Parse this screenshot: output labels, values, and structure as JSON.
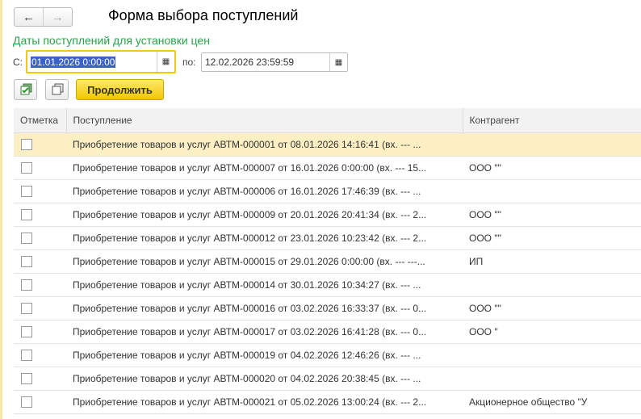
{
  "window": {
    "title": "Форма выбора поступлений"
  },
  "nav": {
    "back": "←",
    "forward": "→"
  },
  "dates": {
    "group_label": "Даты поступлений для установки цен",
    "from_label": "С:",
    "from_value": "01.01.2026  0:00:00",
    "to_label": "по:",
    "to_value": "12.02.2026 23:59:59",
    "calendar_icon": "▦"
  },
  "toolbar": {
    "check_all_icon": "check-all",
    "uncheck_all_icon": "uncheck-all",
    "continue_label": "Продолжить"
  },
  "table": {
    "columns": [
      "Отметка",
      "Поступление",
      "Контрагент"
    ],
    "rows": [
      {
        "doc": "Приобретение товаров и услуг АВТМ-000001 от 08.01.2026 14:16:41 (вх. --- ...",
        "contractor": ""
      },
      {
        "doc": "Приобретение товаров и услуг АВТМ-000007 от 16.01.2026 0:00:00 (вх. --- 15...",
        "contractor": "ООО \"\""
      },
      {
        "doc": "Приобретение товаров и услуг АВТМ-000006 от 16.01.2026 17:46:39 (вх. --- ...",
        "contractor": ""
      },
      {
        "doc": "Приобретение товаров и услуг АВТМ-000009 от 20.01.2026 20:41:34 (вх. --- 2...",
        "contractor": "ООО \"\""
      },
      {
        "doc": "Приобретение товаров и услуг АВТМ-000012 от 23.01.2026 10:23:42 (вх. --- 2...",
        "contractor": "ООО \"\""
      },
      {
        "doc": "Приобретение товаров и услуг АВТМ-000015 от 29.01.2026 0:00:00 (вх. --- ---...",
        "contractor": "ИП"
      },
      {
        "doc": "Приобретение товаров и услуг АВТМ-000014 от 30.01.2026 10:34:27 (вх. --- ...",
        "contractor": ""
      },
      {
        "doc": "Приобретение товаров и услуг АВТМ-000016 от 03.02.2026 16:33:37 (вх. --- 0...",
        "contractor": "ООО \"\""
      },
      {
        "doc": "Приобретение товаров и услуг АВТМ-000017 от 03.02.2026 16:41:28 (вх. --- 0...",
        "contractor": "ООО \""
      },
      {
        "doc": "Приобретение товаров и услуг АВТМ-000019 от 04.02.2026 12:46:26 (вх. --- ...",
        "contractor": ""
      },
      {
        "doc": "Приобретение товаров и услуг АВТМ-000020 от 04.02.2026 20:38:45 (вх. --- ...",
        "contractor": ""
      },
      {
        "doc": "Приобретение товаров и услуг АВТМ-000021 от 05.02.2026 13:00:24 (вх. --- 2...",
        "contractor": "Акционерное общество \"У"
      }
    ]
  }
}
